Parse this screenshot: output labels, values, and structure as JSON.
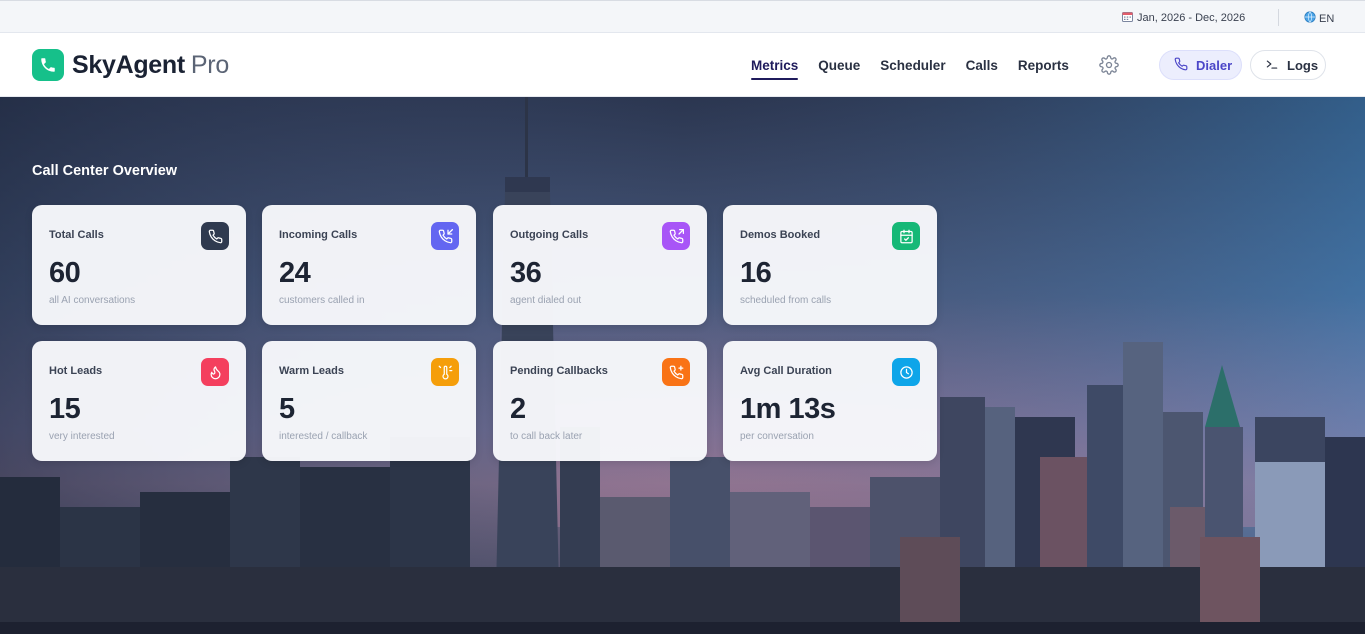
{
  "topbar": {
    "date_range": "Jan, 2026 - Dec, 2026",
    "language": "EN",
    "calendar_icon": "calendar-icon",
    "globe_icon": "globe-icon"
  },
  "brand": {
    "name": "SkyAgent",
    "suffix": "Pro",
    "color": "#16c08a"
  },
  "nav": {
    "items": [
      {
        "label": "Metrics",
        "active": true
      },
      {
        "label": "Queue"
      },
      {
        "label": "Scheduler"
      },
      {
        "label": "Calls"
      },
      {
        "label": "Reports"
      }
    ]
  },
  "actions": {
    "dialer_label": "Dialer",
    "logs_label": "Logs"
  },
  "overview": {
    "title": "Call Center Overview",
    "cards": [
      {
        "label": "Total Calls",
        "value": "60",
        "sub": "all AI conversations",
        "icon": "phone-icon",
        "color": "#2f3a4f"
      },
      {
        "label": "Incoming Calls",
        "value": "24",
        "sub": "customers called in",
        "icon": "phone-incoming-icon",
        "color": "#6366f1"
      },
      {
        "label": "Outgoing Calls",
        "value": "36",
        "sub": "agent dialed out",
        "icon": "phone-outgoing-icon",
        "color": "#a855f7"
      },
      {
        "label": "Demos Booked",
        "value": "16",
        "sub": "scheduled from calls",
        "icon": "calendar-check-icon",
        "color": "#16b877"
      },
      {
        "label": "Hot Leads",
        "value": "15",
        "sub": "very interested",
        "icon": "flame-icon",
        "color": "#f43f5e"
      },
      {
        "label": "Warm Leads",
        "value": "5",
        "sub": "interested / callback",
        "icon": "thermometer-sun-icon",
        "color": "#f59e0b"
      },
      {
        "label": "Pending Callbacks",
        "value": "2",
        "sub": "to call back later",
        "icon": "phone-plus-icon",
        "color": "#f97316"
      },
      {
        "label": "Avg Call Duration",
        "value": "1m 13s",
        "sub": "per conversation",
        "icon": "clock-icon",
        "color": "#0ea5e9"
      }
    ]
  }
}
